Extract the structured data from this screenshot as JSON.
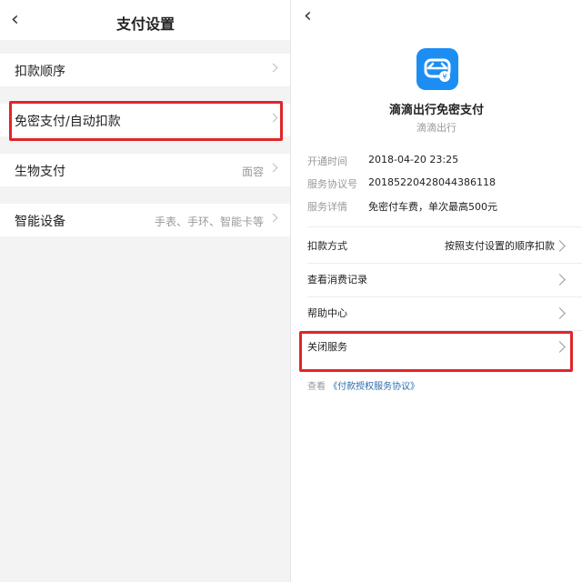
{
  "left": {
    "title": "支付设置",
    "rows": [
      {
        "label": "扣款顺序",
        "value": ""
      },
      {
        "label": "免密支付/自动扣款",
        "value": ""
      },
      {
        "label": "生物支付",
        "value": "面容"
      },
      {
        "label": "智能设备",
        "value": "手表、手环、智能卡等"
      }
    ]
  },
  "right": {
    "app_name": "滴滴出行免密支付",
    "app_sub": "滴滴出行",
    "info": [
      {
        "label": "开通时间",
        "value": "2018-04-20 23:25"
      },
      {
        "label": "服务协议号",
        "value": "20185220428044386118"
      },
      {
        "label": "服务详情",
        "value": "免密付车费，单次最高500元"
      }
    ],
    "rows": [
      {
        "label": "扣款方式",
        "value": "按照支付设置的顺序扣款"
      },
      {
        "label": "查看消费记录",
        "value": ""
      },
      {
        "label": "帮助中心",
        "value": ""
      },
      {
        "label": "关闭服务",
        "value": ""
      }
    ],
    "footer_prefix": "查看",
    "footer_link": "《付款授权服务协议》"
  },
  "colors": {
    "highlight": "#e0252b",
    "logo_blue": "#1c8ef3",
    "link": "#2b6cb0"
  }
}
